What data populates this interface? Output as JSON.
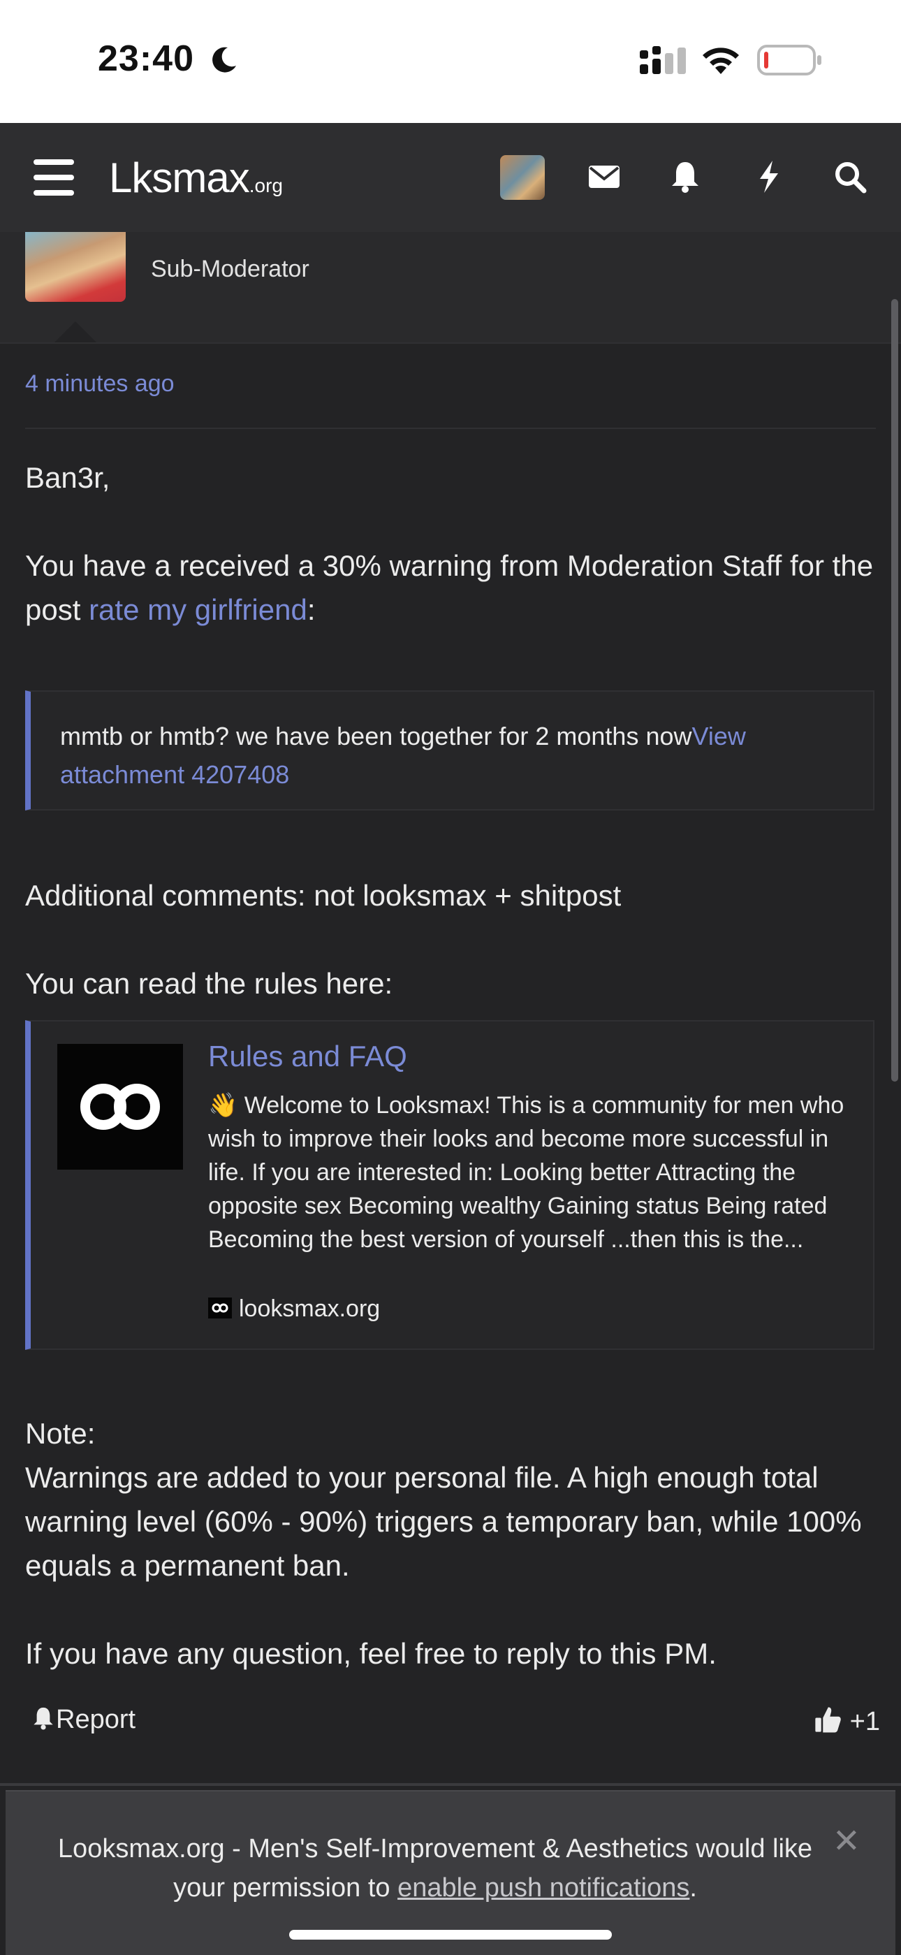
{
  "status_bar": {
    "time": "23:40"
  },
  "nav": {
    "logo_main": "Lksmax",
    "logo_suffix": ".org",
    "icons": [
      "menu-icon",
      "avatar",
      "envelope-icon",
      "bell-icon",
      "lightning-icon",
      "search-icon"
    ]
  },
  "author": {
    "role": "Sub-Moderator"
  },
  "post": {
    "timestamp": "4 minutes ago",
    "greeting": "Ban3r,",
    "warning_prefix": "You have a received a 30% warning from Moderation Staff for the post ",
    "warning_link": "rate my girlfriend",
    "warning_suffix": ":",
    "quote_text": "mmtb or hmtb? we have been together for 2 months now",
    "quote_link": "View attachment 4207408",
    "additional_comments": "Additional comments: not looksmax + shitpost",
    "rules_intro": "You can read the rules here:",
    "unfurl": {
      "title": "Rules and FAQ",
      "description": "👋 Welcome to Looksmax! This is a community for men who wish to improve their looks and become more successful in life. If you are interested in: Looking better Attracting the opposite sex Becoming wealthy Gaining status Being rated Becoming the best version of yourself ...then this is the...",
      "domain": "looksmax.org"
    },
    "note_label": "Note:",
    "note_text": "Warnings are added to your personal file. A high enough total warning level (60% - 90%) triggers a temporary ban, while 100% equals a permanent ban.",
    "closing": "If you have any question, feel free to reply to this PM."
  },
  "actions": {
    "report_label": "Report",
    "like_count": "+1"
  },
  "notification_banner": {
    "text_before": "Looksmax.org - Men's Self-Improvement & Aesthetics would like your permission to ",
    "link": "enable push notifications",
    "text_after": ".",
    "close_glyph": "✕"
  },
  "colors": {
    "background": "#232325",
    "navbar": "#2e2e30",
    "link": "#7b8bd6",
    "quote_border": "#6273c7",
    "author_name": "#8c3fd4"
  }
}
